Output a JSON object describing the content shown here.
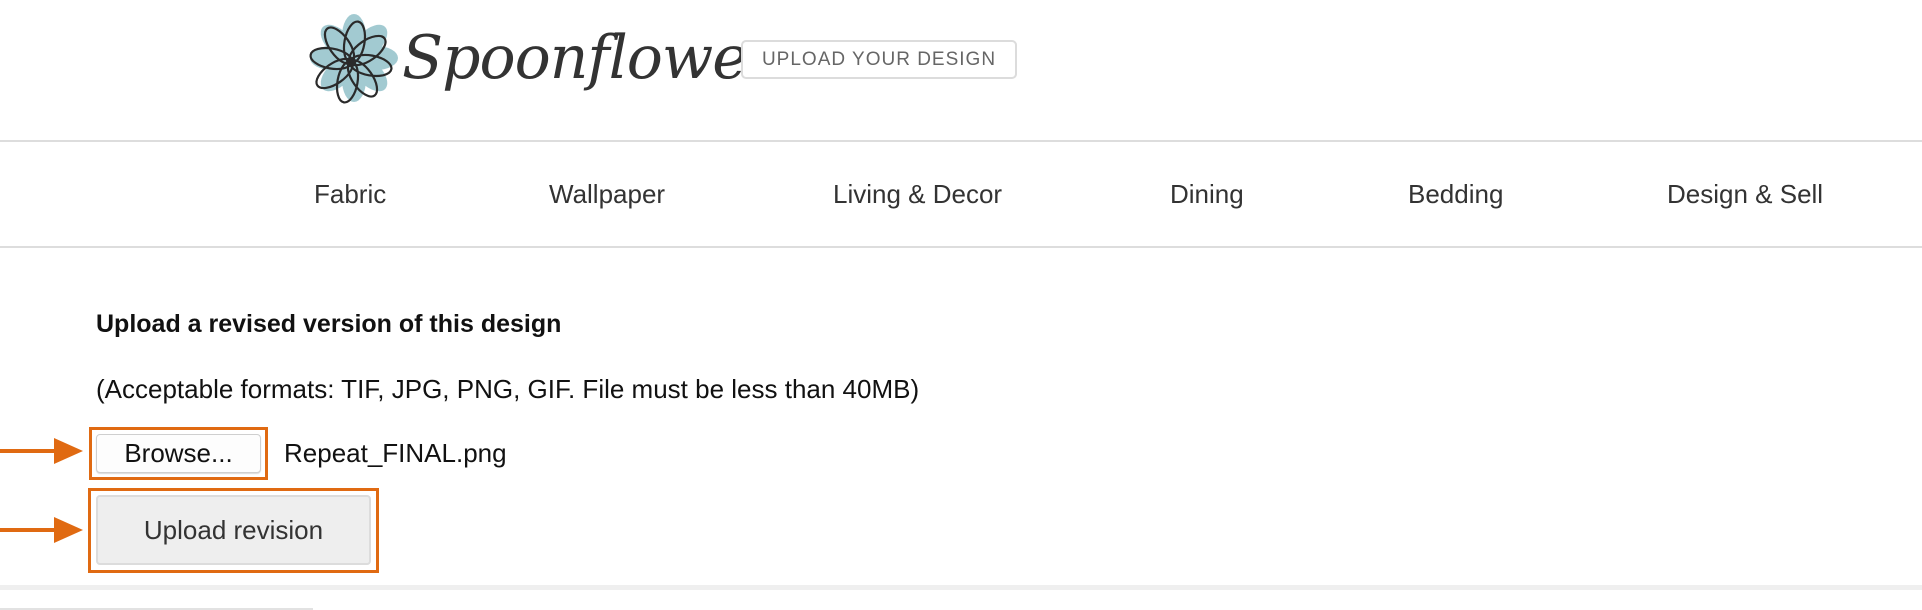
{
  "header": {
    "logo_text": "Spoonflower",
    "upload_design_label": "Upload Your Design"
  },
  "nav": {
    "items": [
      {
        "label": "Fabric"
      },
      {
        "label": "Wallpaper"
      },
      {
        "label": "Living & Decor"
      },
      {
        "label": "Dining"
      },
      {
        "label": "Bedding"
      },
      {
        "label": "Design & Sell"
      }
    ]
  },
  "form": {
    "heading": "Upload a revised version of this design",
    "formats_note": "(Acceptable formats: TIF, JPG, PNG, GIF. File must be less than 40MB)",
    "browse_label": "Browse...",
    "selected_file": "Repeat_FINAL.png",
    "submit_label": "Upload revision"
  },
  "annotations": {
    "highlight_color": "#e06a12",
    "arrow_color": "#e06a12"
  },
  "colors": {
    "logo_petal": "#9ec8cf",
    "text_dark": "#333333",
    "divider": "#dddddd"
  }
}
